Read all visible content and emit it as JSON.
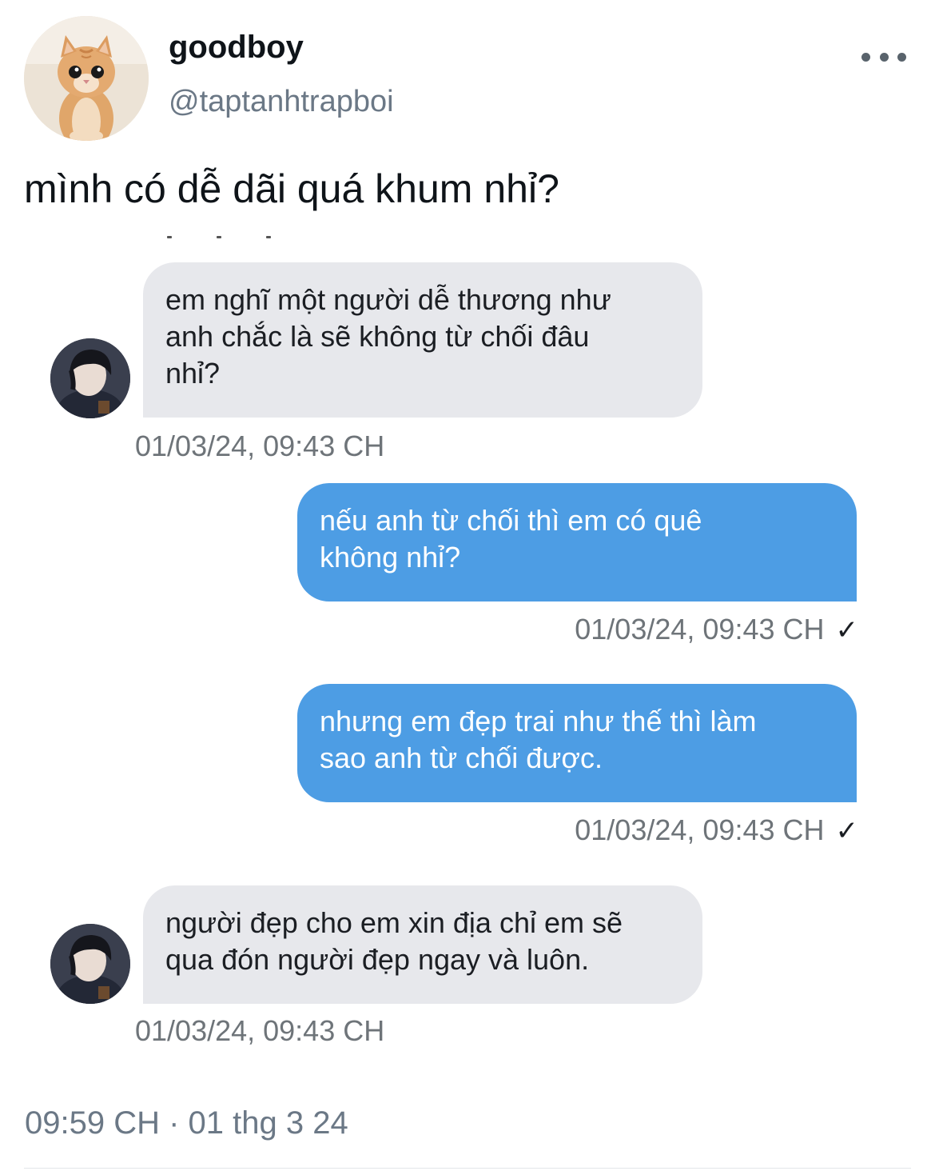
{
  "tweet": {
    "author": {
      "display_name": "goodboy",
      "handle": "@taptanhtrapboi",
      "avatar": "kitten-photo"
    },
    "more_icon": "more-dots-icon",
    "text": "mình có dễ dãi quá khum nhỉ?",
    "timestamp": "09:59 CH · 01 thg 3 24"
  },
  "conversation": {
    "messages": [
      {
        "direction": "incoming",
        "lines": [
          "em nghĩ một người dễ thương như",
          "anh chắc là sẽ không từ chối đâu",
          "nhỉ?"
        ],
        "time": "01/03/24, 09:43 CH"
      },
      {
        "direction": "outgoing",
        "lines": [
          "nếu anh từ chối thì em có quê",
          "không nhỉ?"
        ],
        "time": "01/03/24, 09:43 CH",
        "status_icon": "checkmark-icon",
        "status_glyph": "✓"
      },
      {
        "direction": "outgoing",
        "lines": [
          "nhưng em đẹp trai như thế thì làm",
          "sao anh từ chối được."
        ],
        "time": "01/03/24, 09:43 CH",
        "status_icon": "checkmark-icon",
        "status_glyph": "✓"
      },
      {
        "direction": "incoming",
        "lines": [
          "người đẹp cho em xin địa chỉ em sẽ",
          "qua đón người đẹp ngay và luôn."
        ],
        "time": "01/03/24, 09:43 CH"
      }
    ]
  },
  "colors": {
    "incoming_bubble": "#e7e8ec",
    "outgoing_bubble": "#4d9de4",
    "secondary_text": "#6b7886"
  }
}
